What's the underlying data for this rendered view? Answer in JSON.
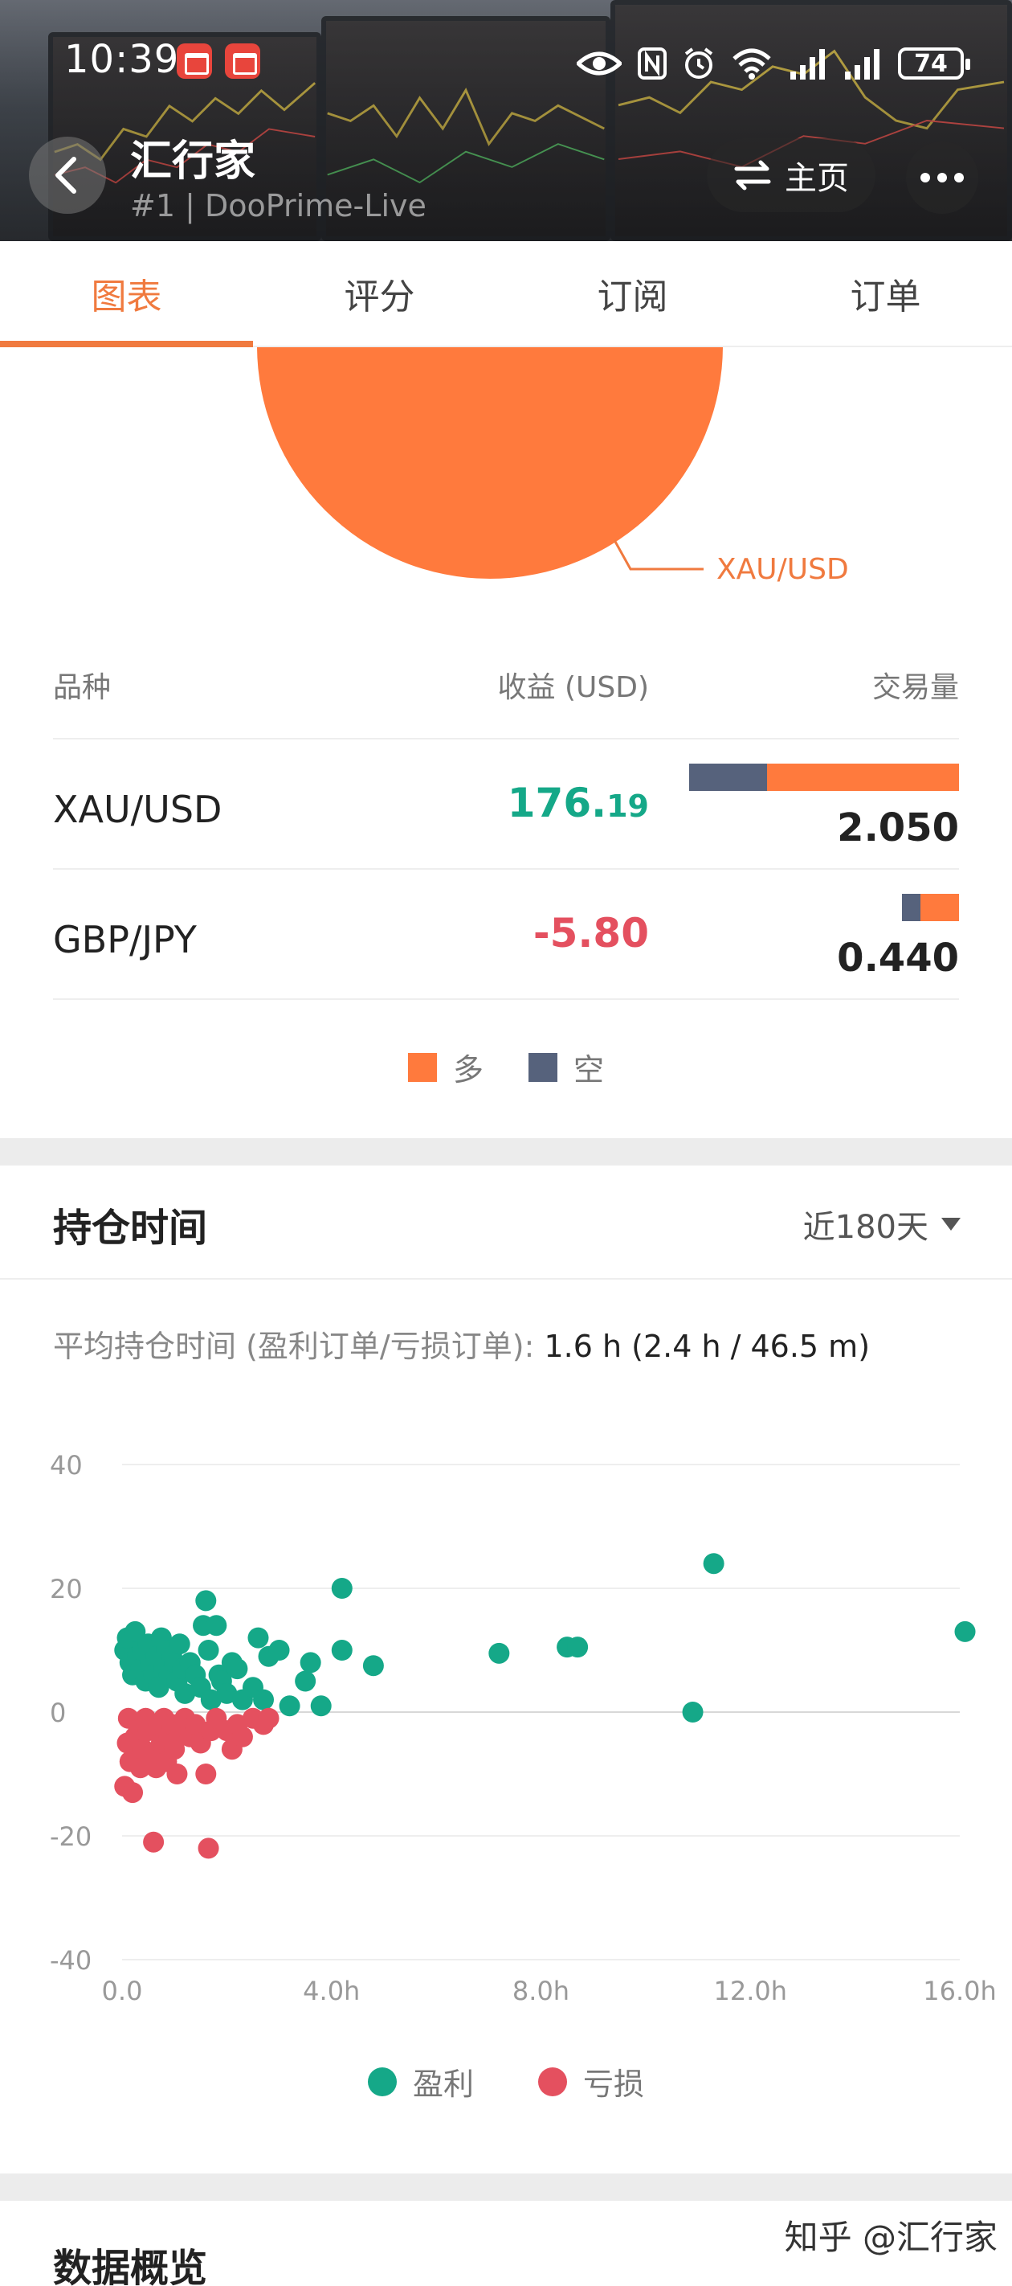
{
  "status_bar": {
    "time": "10:39",
    "battery": "74"
  },
  "header": {
    "title": "汇行家",
    "subtitle": "#1 | DooPrime-Live",
    "home_label": "主页"
  },
  "tabs": [
    {
      "label": "图表",
      "active": true
    },
    {
      "label": "评分",
      "active": false
    },
    {
      "label": "订阅",
      "active": false
    },
    {
      "label": "订单",
      "active": false
    }
  ],
  "pie": {
    "slice_label": "XAU/USD",
    "color": "#ff7a3d"
  },
  "symbol_table": {
    "headers": {
      "symbol": "品种",
      "profit": "收益 (USD)",
      "volume": "交易量"
    },
    "rows": [
      {
        "symbol": "XAU/USD",
        "profit_main": "176.",
        "profit_decimals": "19",
        "profit_sign": "positive",
        "volume": "2.050",
        "short_share": 0.29,
        "long_share": 0.71,
        "volume_share": 1.0
      },
      {
        "symbol": "GBP/JPY",
        "profit_main": "-5.80",
        "profit_decimals": "",
        "profit_sign": "negative",
        "volume": "0.440",
        "short_share": 0.32,
        "long_share": 0.68,
        "volume_share": 0.21
      }
    ]
  },
  "legend_direction": {
    "long": "多",
    "short": "空",
    "long_color": "#ff7a3d",
    "short_color": "#56627c"
  },
  "holding_time": {
    "title": "持仓时间",
    "period": "近180天",
    "avg_label": "平均持仓时间 (盈利订单/亏损订单):",
    "avg_value": "1.6 h (2.4 h / 46.5 m)"
  },
  "chart_data": {
    "type": "scatter",
    "xlabel": "",
    "ylabel": "",
    "x_ticks": [
      "0.0",
      "4.0h",
      "8.0h",
      "12.0h",
      "16.0h"
    ],
    "y_ticks": [
      "40",
      "20",
      "0",
      "-20",
      "-40"
    ],
    "xlim": [
      0,
      16
    ],
    "ylim": [
      -40,
      40
    ],
    "x_unit": "hours",
    "legend": {
      "profit": "盈利",
      "loss": "亏损"
    },
    "colors": {
      "profit": "#15a888",
      "loss": "#e4505f"
    },
    "series": [
      {
        "name": "盈利",
        "points": [
          [
            0.05,
            10
          ],
          [
            0.1,
            12
          ],
          [
            0.15,
            8
          ],
          [
            0.2,
            6
          ],
          [
            0.25,
            13
          ],
          [
            0.3,
            9
          ],
          [
            0.35,
            7
          ],
          [
            0.4,
            10
          ],
          [
            0.45,
            5
          ],
          [
            0.5,
            11
          ],
          [
            0.55,
            8
          ],
          [
            0.6,
            6
          ],
          [
            0.65,
            9
          ],
          [
            0.7,
            4
          ],
          [
            0.75,
            12
          ],
          [
            0.8,
            7
          ],
          [
            0.85,
            10
          ],
          [
            0.9,
            6
          ],
          [
            0.95,
            9
          ],
          [
            1.0,
            8
          ],
          [
            1.05,
            5
          ],
          [
            1.1,
            11
          ],
          [
            1.15,
            7
          ],
          [
            1.2,
            3
          ],
          [
            1.3,
            8
          ],
          [
            1.4,
            6
          ],
          [
            1.5,
            4
          ],
          [
            1.55,
            14
          ],
          [
            1.6,
            18
          ],
          [
            1.65,
            10
          ],
          [
            1.7,
            2
          ],
          [
            1.8,
            14
          ],
          [
            1.85,
            6
          ],
          [
            1.9,
            5
          ],
          [
            2.0,
            3
          ],
          [
            2.1,
            8
          ],
          [
            2.2,
            7
          ],
          [
            2.3,
            2
          ],
          [
            2.5,
            4
          ],
          [
            2.6,
            12
          ],
          [
            2.7,
            2
          ],
          [
            2.8,
            9
          ],
          [
            3.0,
            10
          ],
          [
            3.2,
            1
          ],
          [
            3.5,
            5
          ],
          [
            3.6,
            8
          ],
          [
            3.8,
            1
          ],
          [
            4.2,
            10
          ],
          [
            4.2,
            20
          ],
          [
            4.8,
            7.5
          ],
          [
            7.2,
            9.5
          ],
          [
            8.5,
            10.5
          ],
          [
            8.7,
            10.5
          ],
          [
            10.9,
            0
          ],
          [
            11.3,
            24
          ],
          [
            16.1,
            13
          ]
        ]
      },
      {
        "name": "亏损",
        "points": [
          [
            0.05,
            -12
          ],
          [
            0.1,
            -5
          ],
          [
            0.12,
            -1
          ],
          [
            0.15,
            -8
          ],
          [
            0.2,
            -13
          ],
          [
            0.25,
            -4
          ],
          [
            0.3,
            -2
          ],
          [
            0.35,
            -9
          ],
          [
            0.4,
            -6
          ],
          [
            0.45,
            -1
          ],
          [
            0.5,
            -3
          ],
          [
            0.55,
            -7
          ],
          [
            0.6,
            -21
          ],
          [
            0.65,
            -9
          ],
          [
            0.7,
            -2
          ],
          [
            0.75,
            -5
          ],
          [
            0.8,
            -1
          ],
          [
            0.85,
            -8
          ],
          [
            0.9,
            -4
          ],
          [
            0.95,
            -2
          ],
          [
            1.0,
            -6
          ],
          [
            1.05,
            -10
          ],
          [
            1.1,
            -3
          ],
          [
            1.2,
            -1
          ],
          [
            1.3,
            -4
          ],
          [
            1.4,
            -2
          ],
          [
            1.5,
            -5
          ],
          [
            1.6,
            -10
          ],
          [
            1.65,
            -22
          ],
          [
            1.7,
            -3
          ],
          [
            1.8,
            -1
          ],
          [
            2.0,
            -3
          ],
          [
            2.1,
            -6
          ],
          [
            2.2,
            -2
          ],
          [
            2.3,
            -4
          ],
          [
            2.5,
            -1
          ],
          [
            2.7,
            -2
          ],
          [
            2.8,
            -1
          ]
        ]
      }
    ]
  },
  "overview": {
    "title": "数据概览"
  },
  "watermark": "知乎 @汇行家"
}
